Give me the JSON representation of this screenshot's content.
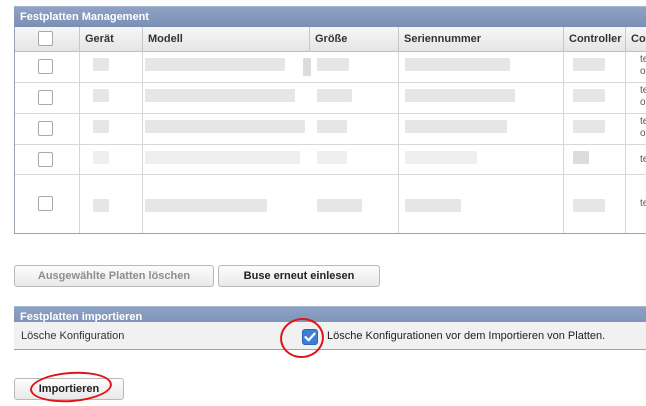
{
  "management": {
    "title": "Festplatten Management",
    "columns": [
      "Gerät",
      "Modell",
      "Größe",
      "Seriennummer",
      "Controller",
      "Co"
    ],
    "row_count": 5,
    "cut_text": [
      "te",
      "on",
      "te",
      "on",
      "te",
      "on",
      "te",
      "te"
    ]
  },
  "buttons": {
    "delete_selected": "Ausgewählte Platten löschen",
    "rescan_bus": "Buse erneut einlesen",
    "import": "Importieren"
  },
  "import_section": {
    "title": "Festplatten importieren",
    "label": "Lösche Konfiguration",
    "checkbox_checked": true,
    "checkbox_text": "Lösche Konfigurationen vor dem Importieren von Platten."
  },
  "colors": {
    "header_bg": "#7b90b5",
    "checkbox_accent": "#3d7fd4",
    "annotation_circle": "#e01414"
  }
}
